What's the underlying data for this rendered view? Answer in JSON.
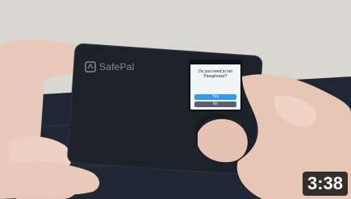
{
  "video": {
    "duration": "3:38"
  },
  "device": {
    "brand_label": "SafePal",
    "screen_prompt": "Do you need to set Passphrase?",
    "yes_label": "Yes",
    "no_label": "No"
  },
  "colors": {
    "table": "#1c2230",
    "card": "#1d2129",
    "screen": "#f2f5f8",
    "accent": "#2f9bf0",
    "wall": "#dcdad6",
    "skin": "#e7c7b7"
  }
}
